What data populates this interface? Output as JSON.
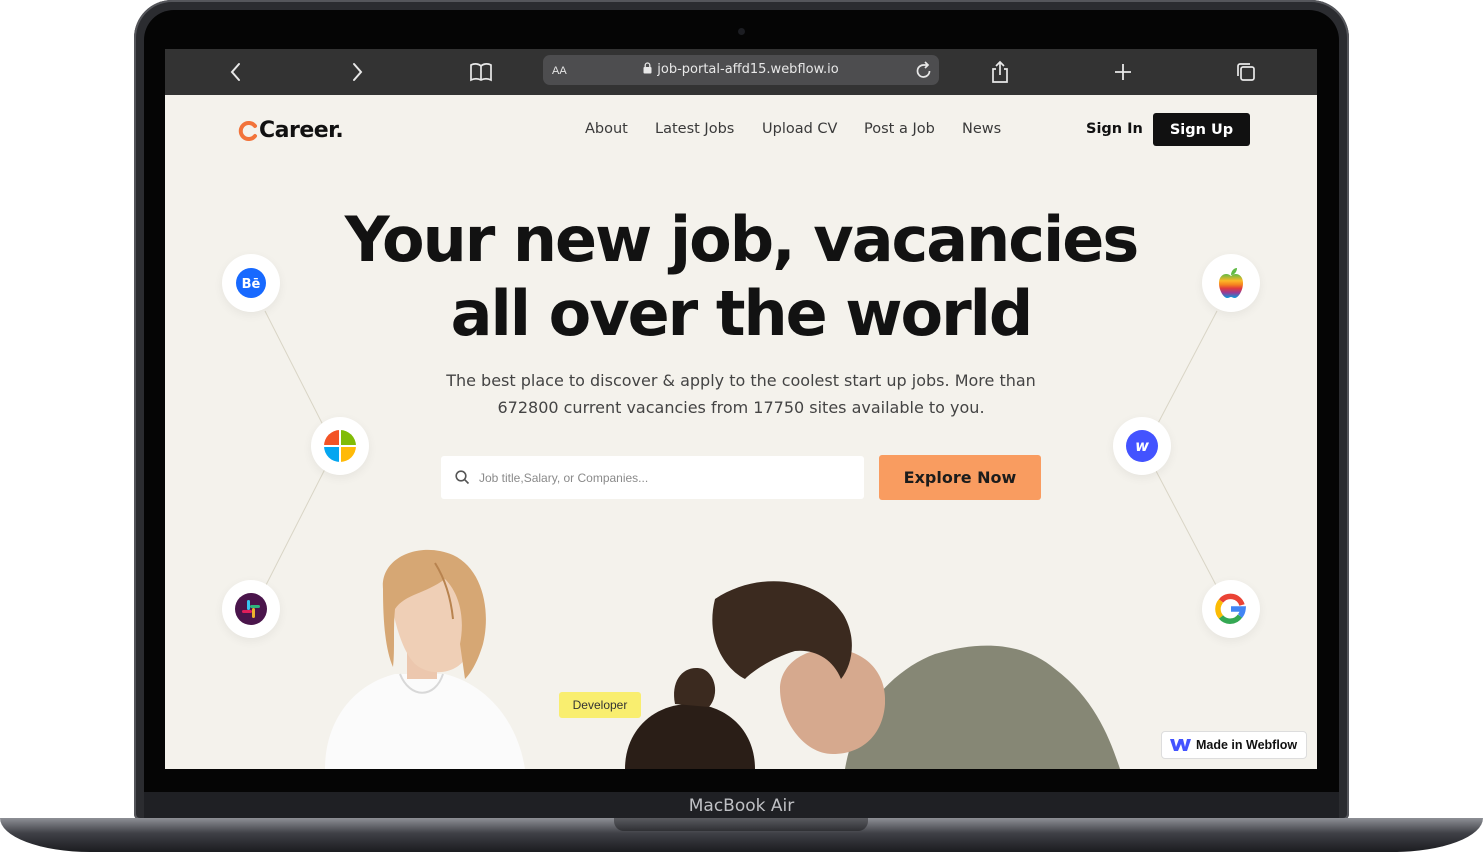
{
  "device": {
    "label": "MacBook Air"
  },
  "browser": {
    "url": "job-portal-affd15.webflow.io",
    "text_size_label": "AA",
    "icons": [
      "back-icon",
      "forward-icon",
      "bookmarks-icon",
      "lock-icon",
      "reload-icon",
      "share-icon",
      "new-tab-icon",
      "tabs-icon"
    ]
  },
  "site": {
    "logo_text": "Career.",
    "nav": [
      {
        "label": "About"
      },
      {
        "label": "Latest Jobs"
      },
      {
        "label": "Upload CV"
      },
      {
        "label": "Post a Job"
      },
      {
        "label": "News"
      }
    ],
    "sign_in": "Sign In",
    "sign_up": "Sign Up",
    "accent_color": "#f99c60",
    "dark_color": "#111111",
    "background_color": "#f4f2ec"
  },
  "hero": {
    "title_line1": "Your new job, vacancies",
    "title_line2": "all over the world",
    "subtitle_line1": "The best place to discover & apply to the coolest start up jobs. More than",
    "subtitle_line2": "672800 current vacancies from 17750 sites available to you.",
    "search_placeholder": "Job title,Salary, or Companies...",
    "cta": "Explore Now",
    "tag": "Developer"
  },
  "company_icons": [
    "behance-icon",
    "microsoft-icon",
    "slack-icon",
    "apple-icon",
    "webflow-icon",
    "google-icon"
  ],
  "footer_badge": "Made in Webflow"
}
